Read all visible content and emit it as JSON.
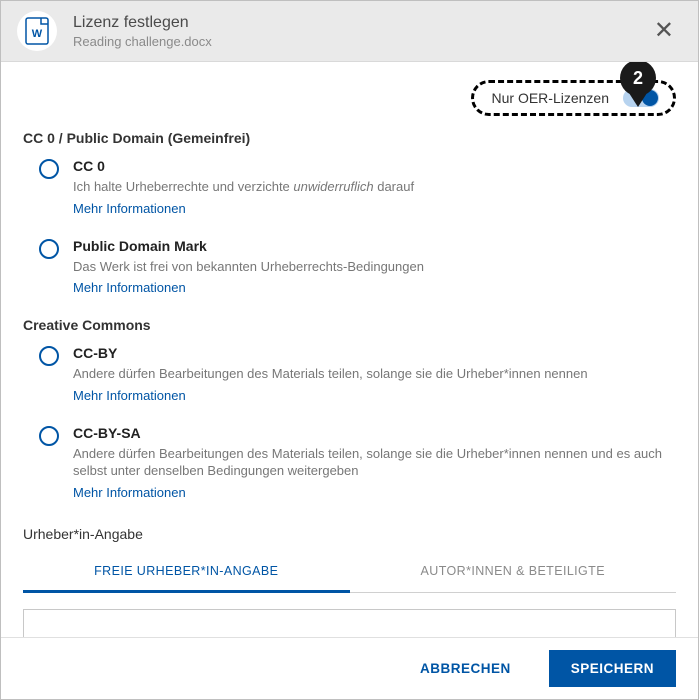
{
  "header": {
    "title": "Lizenz festlegen",
    "subtitle": "Reading challenge.docx"
  },
  "callout_number": "2",
  "oer_toggle": {
    "label": "Nur OER-Lizenzen",
    "on": true
  },
  "groups": [
    {
      "title": "CC 0 / Public Domain (Gemeinfrei)",
      "options": [
        {
          "label": "CC 0",
          "desc_pre": "Ich halte Urheberrechte und verzichte ",
          "desc_em": "unwiderruflich",
          "desc_post": " darauf",
          "link": "Mehr Informationen"
        },
        {
          "label": "Public Domain Mark",
          "desc_pre": "Das Werk ist frei von bekannten Urheberrechts-Bedingungen",
          "desc_em": "",
          "desc_post": "",
          "link": "Mehr Informationen"
        }
      ]
    },
    {
      "title": "Creative Commons",
      "options": [
        {
          "label": "CC-BY",
          "desc_pre": "Andere dürfen Bearbeitungen des Materials teilen, solange sie die Urheber*innen nennen",
          "desc_em": "",
          "desc_post": "",
          "link": "Mehr Informationen"
        },
        {
          "label": "CC-BY-SA",
          "desc_pre": "Andere dürfen Bearbeitungen des Materials teilen, solange sie die Urheber*innen nennen und es auch selbst unter denselben Bedingungen weitergeben",
          "desc_em": "",
          "desc_post": "",
          "link": "Mehr Informationen"
        }
      ]
    }
  ],
  "author_section_title": "Urheber*in-Angabe",
  "tabs": {
    "active": "FREIE URHEBER*IN-ANGABE",
    "inactive": "AUTOR*INNEN & BETEILIGTE"
  },
  "author_input_value": "",
  "footer": {
    "cancel": "ABBRECHEN",
    "save": "SPEICHERN"
  }
}
